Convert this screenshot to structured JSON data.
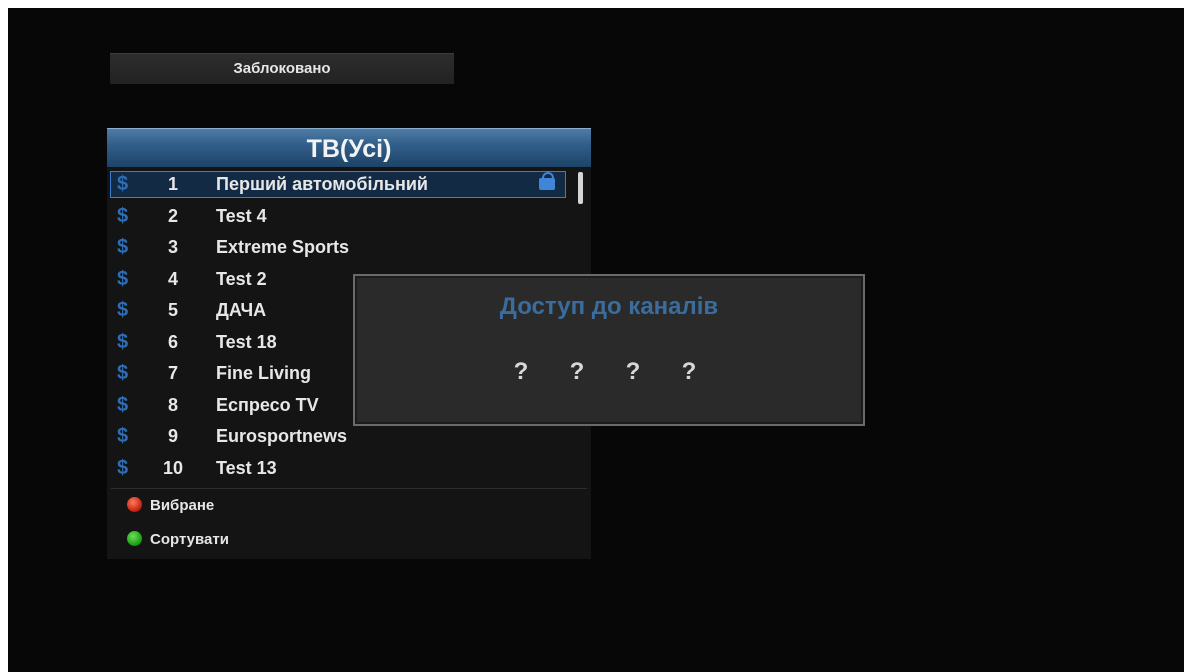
{
  "status": {
    "text": "Заблоковано"
  },
  "panel": {
    "title": "ТВ(Усі)"
  },
  "channels": [
    {
      "symbol": "$",
      "num": "1",
      "name": "Перший автомобільний",
      "locked": true
    },
    {
      "symbol": "$",
      "num": "2",
      "name": "Test 4"
    },
    {
      "symbol": "$",
      "num": "3",
      "name": "Extreme Sports"
    },
    {
      "symbol": "$",
      "num": "4",
      "name": "Test 2"
    },
    {
      "symbol": "$",
      "num": "5",
      "name": "ДАЧА"
    },
    {
      "symbol": "$",
      "num": "6",
      "name": "Test 18"
    },
    {
      "symbol": "$",
      "num": "7",
      "name": "Fine Living"
    },
    {
      "symbol": "$",
      "num": "8",
      "name": "Еспресо TV"
    },
    {
      "symbol": "$",
      "num": "9",
      "name": "Eurosportnews"
    },
    {
      "symbol": "$",
      "num": "10",
      "name": "Test 13"
    }
  ],
  "legend": {
    "red_label": "Вибране",
    "green_label": "Сортувати"
  },
  "dialog": {
    "title": "Доступ до каналів",
    "pin": [
      "?",
      "?",
      "?",
      "?"
    ]
  },
  "colors": {
    "accent_blue": "#2f5c87",
    "dollar_blue": "#2e6eb6",
    "red_key": "#c2200c",
    "green_key": "#149b0e"
  },
  "icons": {
    "lock": "lock-icon",
    "currency": "dollar-icon"
  }
}
